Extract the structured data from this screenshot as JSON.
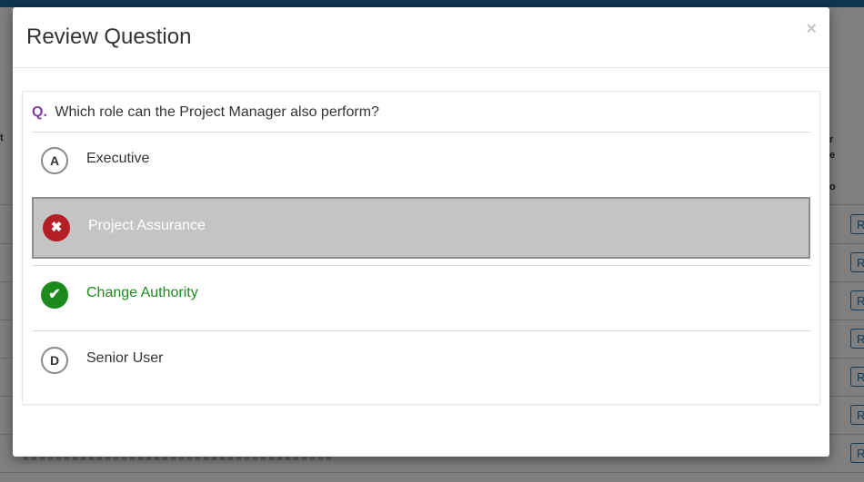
{
  "background": {
    "header_fragments": [
      "t",
      "r",
      "e",
      "o"
    ],
    "row_button_label": "R",
    "row_count": 7
  },
  "modal": {
    "title": "Review Question",
    "close_symbol": "×"
  },
  "question": {
    "prefix": "Q.",
    "text": "Which role can the Project Manager also perform?"
  },
  "options": [
    {
      "letter": "A",
      "label": "Executive",
      "state": "neutral"
    },
    {
      "letter": "✖",
      "label": "Project Assurance",
      "state": "wrong-selected"
    },
    {
      "letter": "✔",
      "label": "Change Authority",
      "state": "correct"
    },
    {
      "letter": "D",
      "label": "Senior User",
      "state": "neutral"
    }
  ],
  "colors": {
    "wrong_icon": "#b31f24",
    "correct_icon": "#1c8a1c",
    "correct_text": "#1d8a1d",
    "question_prefix": "#7b3fa3",
    "selected_row_bg": "#c4c4c4",
    "topbar": "#1d6aa5"
  }
}
